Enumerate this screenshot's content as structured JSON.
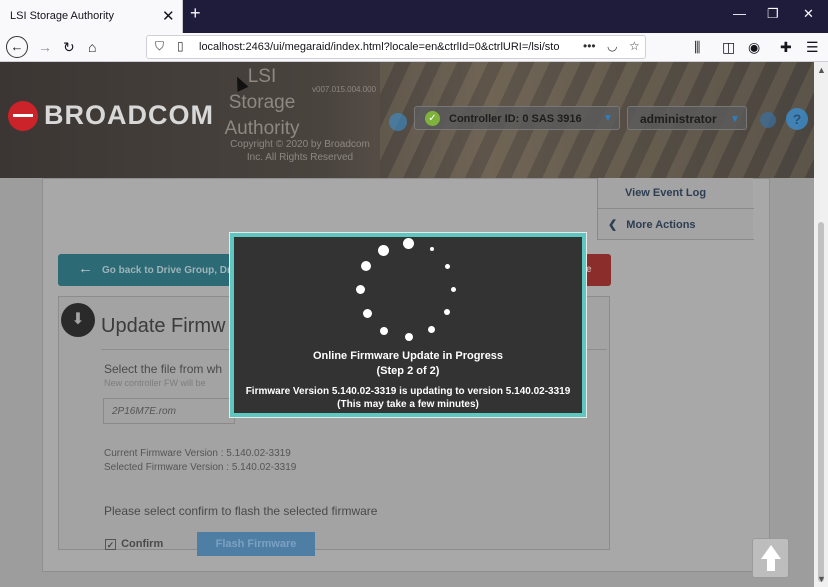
{
  "browser": {
    "tab_title": "LSI Storage Authority",
    "tab_close": "✕",
    "new_tab": "+",
    "window_controls": {
      "minimize": "—",
      "restore": "❐",
      "close": "✕"
    },
    "url": "localhost:2463/ui/megaraid/index.html?locale=en&ctrlId=0&ctrlURI=/lsi/sto",
    "toolbar_icons": [
      "back-icon",
      "forward-icon",
      "reload-icon",
      "home-icon",
      "shield-icon",
      "page-icon",
      "more-icon",
      "pocket-icon",
      "star-icon",
      "library-icon",
      "sidebar-icon",
      "account-icon",
      "extension-icon",
      "menu-icon"
    ]
  },
  "header": {
    "brand": "BROADCOM",
    "app_title": "LSI Storage Authority",
    "version": "v007.015.004.000",
    "copyright": "Copyright © 2020 by Broadcom Inc. All Rights Reserved",
    "controller": "Controller ID: 0 SAS 3916",
    "user": "administrator",
    "help": "?"
  },
  "side_menu": {
    "items": [
      {
        "label": "View Event Log"
      },
      {
        "label": "More Actions",
        "prefix": "❮"
      }
    ]
  },
  "back_bar": {
    "label": "Go back to Drive Group, Dr",
    "right_letter": "e"
  },
  "card": {
    "title": "Update Firmw",
    "select_text": "Select the file from wh",
    "select_hint": "New controller FW will be",
    "file_name": "2P16M7E.rom",
    "current_version": "Current Firmware Version : 5.140.02-3319",
    "selected_version": "Selected Firmware Version : 5.140.02-3319",
    "hint": "Please select confirm to flash the selected firmware",
    "confirm_label": "Confirm",
    "confirm_checked": true,
    "flash_button": "Flash Firmware"
  },
  "modal": {
    "title": "Online Firmware Update in Progress",
    "step": "(Step 2 of 2)",
    "message": "Firmware Version 5.140.02-3319 is updating to version 5.140.02-3319",
    "note": "(This may take a few minutes)"
  },
  "colors": {
    "modal_border": "#5ec7bf",
    "modal_bg": "#333333",
    "brand_red": "#cc2229",
    "back_bar": "#2c6a76"
  }
}
